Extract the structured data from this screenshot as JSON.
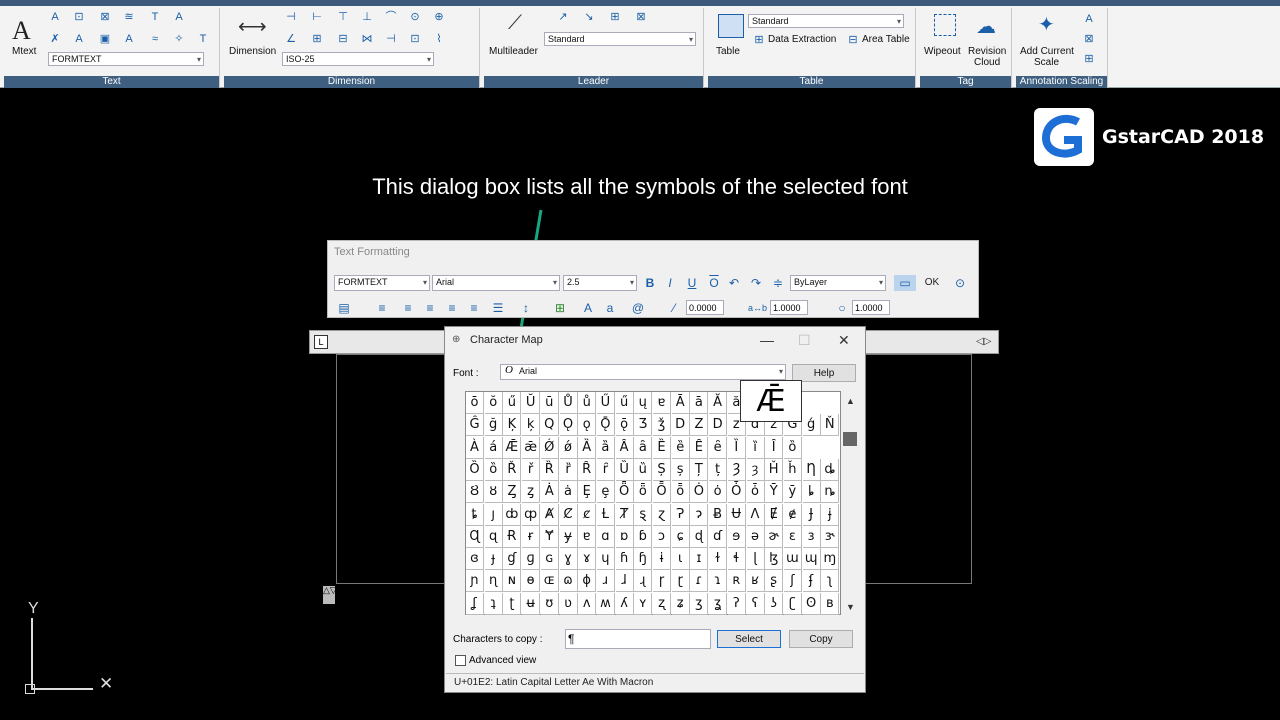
{
  "ribbon": {
    "panels": {
      "text": "Text",
      "dimension": "Dimension",
      "leader": "Leader",
      "table": "Table",
      "tag": "Tag",
      "annotation_scaling": "Annotation Scaling"
    },
    "mtext_label": "Mtext",
    "text_style": "FORMTEXT",
    "dimension_label": "Dimension",
    "dim_style": "ISO-25",
    "multileader_label": "Multileader",
    "leader_style": "Standard",
    "table_label": "Table",
    "table_style": "Standard",
    "data_extraction": "Data Extraction",
    "area_table": "Area Table",
    "wipeout": "Wipeout",
    "revision_cloud_1": "Revision",
    "revision_cloud_2": "Cloud",
    "add_current_1": "Add Current",
    "add_current_2": "Scale"
  },
  "caption": "This dialog box lists all the symbols of the selected font",
  "brand": "GstarCAD 2018",
  "text_formatting": {
    "title": "Text Formatting",
    "style": "FORMTEXT",
    "font": "Arial",
    "height": "2.5",
    "color": "ByLayer",
    "ok": "OK",
    "oblique": "0.0000",
    "tracking": "1.0000",
    "width": "1.0000"
  },
  "charmap": {
    "title": "Character Map",
    "font_label": "Font :",
    "font_value": "Arial",
    "help": "Help",
    "zoom_char": "Ǣ",
    "rows": [
      "ōŏűŬūŮůŰűųɐĀāĂăĞǵ",
      "ĜğĶķQǪǫǬǭƷǯDZDzdzǴǵŇň",
      "ÀáǢǣǾǿȀȁȂȃȄȅȆȇȈȉȊȍ",
      "ȌȍŘřȐȑȒȓȔȕȘșȚțȜȝȞȟȠȡ",
      "ȢȣȤȥȦȧȨȩȪȫȬȭȮȯȰȱȲȳȴȵ",
      "ȶȷȸȹȺȻȼȽȾȿɀɁɂɃɄɅɆɇɈɉ",
      "ɊɋɌɍɎɏɐɑɒɓɔɕɖɗɘəɚɛɜɝ",
      "ɞɟɠɡɢɣɤɥɦɧɨɩɪɫɬɭɮɯɰɱ",
      "ɲɳɴɵɶɷɸɹɺɻɼɽɾɿʀʁʂʃʄʅ",
      "ʆʇʈʉʊʋʌʍʎʏʐʑʒʓʔʕʖʗʘʙ"
    ],
    "copy_label": "Characters to copy :",
    "copy_value": "¶",
    "select": "Select",
    "copy": "Copy",
    "advanced": "Advanced view",
    "status": "U+01E2: Latin Capital Letter Ae With Macron"
  },
  "ucs": {
    "y": "Y"
  }
}
